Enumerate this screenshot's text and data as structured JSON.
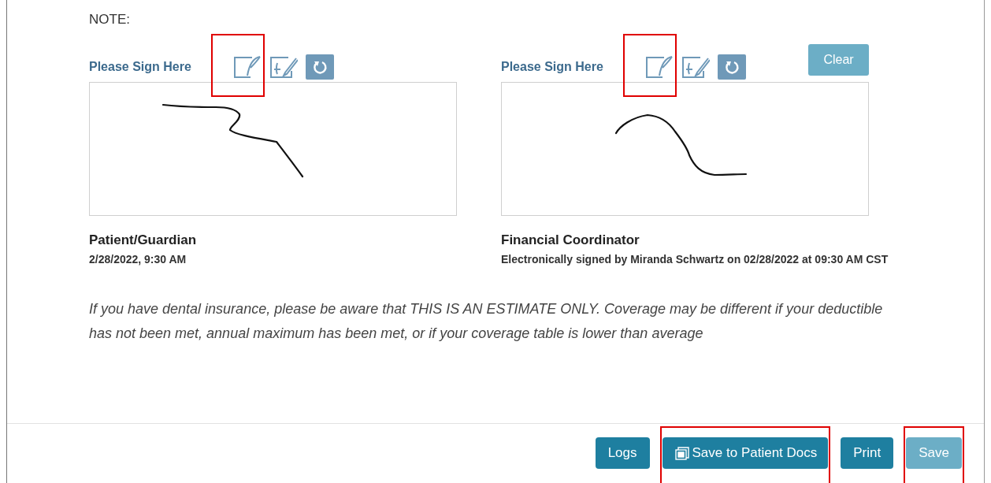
{
  "note_label": "NOTE:",
  "clear_button": {
    "label": "Clear",
    "disabled": true
  },
  "signatures": [
    {
      "prompt": "Please Sign Here",
      "highlighted": true,
      "role": "Patient/Guardian",
      "detail": "2/28/2022, 9:30 AM"
    },
    {
      "prompt": "Please Sign Here",
      "highlighted": true,
      "role": "Financial Coordinator",
      "detail": "Electronically signed by Miranda Schwartz on 02/28/2022 at 09:30 AM CST"
    }
  ],
  "disclaimer": "If you have dental insurance, please be aware that THIS IS AN ESTIMATE ONLY. Coverage may be different if your deductible has not been met, annual maximum has been met, or if your coverage table is lower than average",
  "footer_buttons": [
    {
      "label": "Logs",
      "kind": "plain",
      "disabled": false,
      "highlighted": false
    },
    {
      "label": "Save to Patient Docs",
      "kind": "with-icon",
      "disabled": false,
      "highlighted": true
    },
    {
      "label": "Print",
      "kind": "plain",
      "disabled": false,
      "highlighted": false
    },
    {
      "label": "Save",
      "kind": "plain",
      "disabled": true,
      "highlighted": true
    }
  ]
}
